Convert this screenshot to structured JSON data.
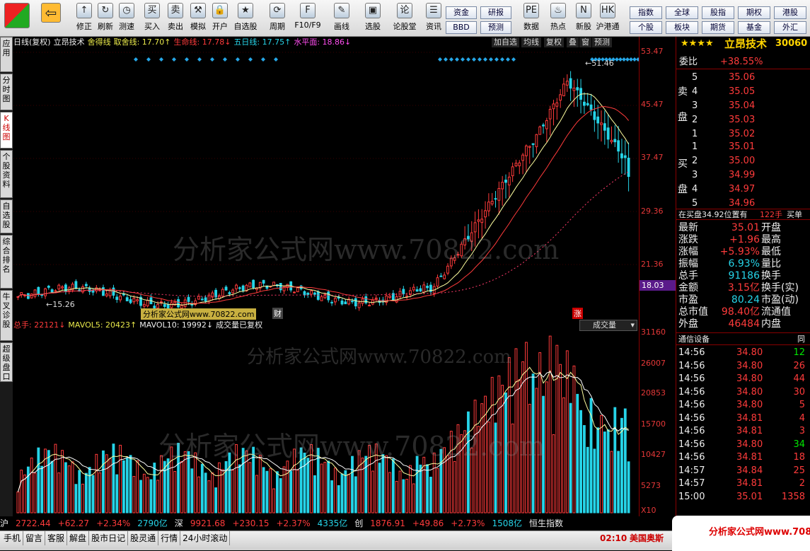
{
  "toolbar": {
    "buttons": [
      {
        "label": "修正",
        "icon": "up-arrow-icon",
        "glyph": "↑"
      },
      {
        "label": "刷新",
        "icon": "refresh-icon",
        "glyph": "↻"
      },
      {
        "label": "测速",
        "icon": "clock-icon",
        "glyph": "◷"
      },
      {
        "label": "买入",
        "icon": "buy-icon",
        "glyph": "买"
      },
      {
        "label": "卖出",
        "icon": "sell-icon",
        "glyph": "卖"
      },
      {
        "label": "模拟",
        "icon": "hammer-icon",
        "glyph": "⚒"
      },
      {
        "label": "开户",
        "icon": "lock-icon",
        "glyph": "🔒"
      },
      {
        "label": "自选股",
        "icon": "star-icon",
        "glyph": "★"
      },
      {
        "label": "周期",
        "icon": "cycle-icon",
        "glyph": "⟳"
      },
      {
        "label": "F10/F9",
        "icon": "f10-icon",
        "glyph": "F"
      },
      {
        "label": "画线",
        "icon": "pen-icon",
        "glyph": "✎"
      },
      {
        "label": "选股",
        "icon": "monitor-icon",
        "glyph": "▣"
      },
      {
        "label": "论股堂",
        "icon": "discuss-icon",
        "glyph": "论"
      },
      {
        "label": "资讯",
        "icon": "news-icon",
        "glyph": "☰"
      },
      {
        "label": "数据",
        "icon": "pe-icon",
        "glyph": "PE"
      },
      {
        "label": "热点",
        "icon": "fire-icon",
        "glyph": "♨"
      },
      {
        "label": "新股",
        "icon": "newstock-icon",
        "glyph": "N"
      },
      {
        "label": "沪港通",
        "icon": "hk-icon",
        "glyph": "HK"
      }
    ],
    "small_buttons": [
      "资金",
      "研报",
      "BBD",
      "预测"
    ],
    "market_buttons": [
      "指数",
      "全球",
      "股指",
      "期权",
      "港股",
      "个股",
      "板块",
      "期货",
      "基金",
      "外汇"
    ]
  },
  "side_tabs": [
    "应用",
    "分时图",
    "K线图",
    "个股资料",
    "自选股",
    "综合排名",
    "牛叉诊股",
    "超级盘口"
  ],
  "kline": {
    "info": [
      {
        "text": "日线(复权)",
        "cls": "white"
      },
      {
        "text": "立昂技术",
        "cls": "white"
      },
      {
        "text": "舍得线",
        "cls": "yellow"
      },
      {
        "text": "取舍线: 17.70↑",
        "cls": "yellow"
      },
      {
        "text": "生命线: 17.78↓",
        "cls": "red"
      },
      {
        "text": "五日线: 17.75↑",
        "cls": "cyan"
      },
      {
        "text": "水平面: 18.86↓",
        "cls": "magenta"
      }
    ],
    "right_buttons": [
      "加自选",
      "均线",
      "复权",
      "叠",
      "窗",
      "预测"
    ],
    "axis_labels": [
      "53.47",
      "45.47",
      "37.47",
      "29.36",
      "21.36"
    ],
    "current_price_tag": "18.03",
    "high_label": "51.46",
    "low_label": "15.26",
    "marker_cai": "财",
    "marker_zhang": "涨"
  },
  "volume": {
    "info": [
      {
        "text": "总手: 22121↓",
        "cls": "red"
      },
      {
        "text": "MAVOL5: 20423↑",
        "cls": "yellow"
      },
      {
        "text": "MAVOL10: 19992↓",
        "cls": "white"
      },
      {
        "text": "成交量已复权",
        "cls": "white"
      }
    ],
    "selector_label": "成交量",
    "axis_labels": [
      "31160",
      "26007",
      "20853",
      "15700",
      "10427",
      "5273"
    ],
    "unit_label": "X10"
  },
  "watermark": {
    "text": "分析家公式网www.70822.com",
    "small": "分析家公式网www.70822.com"
  },
  "right_panel": {
    "title": "立昂技术",
    "code": "30060",
    "stars": "★★★★",
    "weibi_label": "委比",
    "weibi_value": "+38.55%",
    "sell_label": "卖盘",
    "buy_label": "买盘",
    "asks": [
      {
        "level": "5",
        "price": "35.06"
      },
      {
        "level": "4",
        "price": "35.05"
      },
      {
        "level": "3",
        "price": "35.04"
      },
      {
        "level": "2",
        "price": "35.03"
      },
      {
        "level": "1",
        "price": "35.02"
      }
    ],
    "bids": [
      {
        "level": "1",
        "price": "35.01"
      },
      {
        "level": "2",
        "price": "35.00"
      },
      {
        "level": "3",
        "price": "34.99"
      },
      {
        "level": "4",
        "price": "34.97"
      },
      {
        "level": "5",
        "price": "34.96"
      }
    ],
    "buy_line": "在买盘34.92位置有",
    "buy_line_qty": "122手",
    "buy_line_tag": "买单",
    "quote": [
      {
        "l": "最新",
        "v": "35.01",
        "r": "开盘"
      },
      {
        "l": "涨跌",
        "v": "+1.96",
        "r": "最高"
      },
      {
        "l": "涨幅",
        "v": "+5.93%",
        "r": "最低"
      },
      {
        "l": "振幅",
        "v": "6.93%",
        "r": "量比"
      },
      {
        "l": "总手",
        "v": "91186",
        "r": "换手"
      },
      {
        "l": "金额",
        "v": "3.15亿",
        "r": "换手(实)"
      },
      {
        "l": "市盈",
        "v": "80.24",
        "r": "市盈(动)"
      },
      {
        "l": "总市值",
        "v": "98.40亿",
        "r": "流通值"
      },
      {
        "l": "外盘",
        "v": "46484",
        "r": "内盘"
      }
    ],
    "ticks_header": "通信设备",
    "ticks": [
      {
        "t": "14:56",
        "p": "34.80",
        "q": "12",
        "c": "green"
      },
      {
        "t": "14:56",
        "p": "34.80",
        "q": "26",
        "c": "red"
      },
      {
        "t": "14:56",
        "p": "34.80",
        "q": "44",
        "c": "red"
      },
      {
        "t": "14:56",
        "p": "34.80",
        "q": "30",
        "c": "red"
      },
      {
        "t": "14:56",
        "p": "34.80",
        "q": "5",
        "c": "red"
      },
      {
        "t": "14:56",
        "p": "34.81",
        "q": "4",
        "c": "red"
      },
      {
        "t": "14:56",
        "p": "34.81",
        "q": "3",
        "c": "red"
      },
      {
        "t": "14:56",
        "p": "34.80",
        "q": "34",
        "c": "green"
      },
      {
        "t": "14:56",
        "p": "34.81",
        "q": "18",
        "c": "red"
      },
      {
        "t": "14:57",
        "p": "34.84",
        "q": "25",
        "c": "red"
      },
      {
        "t": "14:57",
        "p": "34.81",
        "q": "2",
        "c": "red"
      },
      {
        "t": "15:00",
        "p": "35.01",
        "q": "1358",
        "c": "red"
      }
    ]
  },
  "status": [
    {
      "text": "沪",
      "cls": "white"
    },
    {
      "text": "2722.44",
      "cls": "red"
    },
    {
      "text": "+62.27",
      "cls": "red"
    },
    {
      "text": "+2.34%",
      "cls": "red"
    },
    {
      "text": "2790亿",
      "cls": "cyan"
    },
    {
      "text": "深",
      "cls": "white"
    },
    {
      "text": "9921.68",
      "cls": "red"
    },
    {
      "text": "+230.15",
      "cls": "red"
    },
    {
      "text": "+2.37%",
      "cls": "red"
    },
    {
      "text": "4335亿",
      "cls": "cyan"
    },
    {
      "text": "创",
      "cls": "white"
    },
    {
      "text": "1876.91",
      "cls": "red"
    },
    {
      "text": "+49.86",
      "cls": "red"
    },
    {
      "text": "+2.73%",
      "cls": "red"
    },
    {
      "text": "1508亿",
      "cls": "cyan"
    },
    {
      "text": "恒生指数",
      "cls": "white"
    }
  ],
  "bottom": {
    "items": [
      "手机",
      "留言",
      "客服",
      "解盘",
      "股市日记",
      "股灵通",
      "行情",
      "24小时滚动"
    ],
    "clock": "02:10",
    "ticker": "美国奥斯"
  },
  "chart_data": {
    "type": "candlestick",
    "title": "立昂技术",
    "ylim": [
      15,
      53.47
    ],
    "high": 51.46,
    "low": 15.26,
    "last": 35.01,
    "ma_labels": [
      "取舍线",
      "生命线",
      "五日线",
      "水平面"
    ],
    "volume_ylim": [
      0,
      31160
    ],
    "volume_labels": [
      "总手",
      "MAVOL5",
      "MAVOL10"
    ]
  }
}
